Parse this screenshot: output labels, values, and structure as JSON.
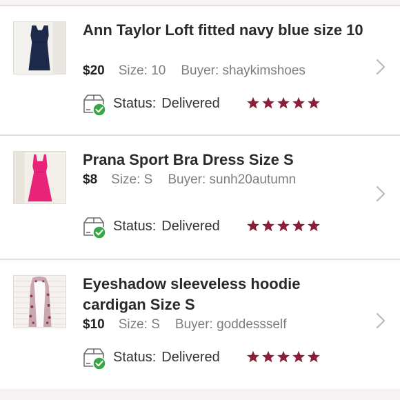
{
  "colors": {
    "star": "#8a1f3a",
    "status_check": "#3aa648",
    "chevron": "#b8b8b8"
  },
  "orders": [
    {
      "title": "Ann Taylor Loft fitted navy blue size 10",
      "price": "$20",
      "size": "Size: 10",
      "buyer": "Buyer: shaykimshoes",
      "status_label": "Status:",
      "status_value": "Delivered",
      "rating": 5,
      "thumb_icon": "navy-dress-photo"
    },
    {
      "title": "Prana Sport Bra Dress Size S",
      "price": "$8",
      "size": "Size: S",
      "buyer": "Buyer: sunh20autumn",
      "status_label": "Status:",
      "status_value": "Delivered",
      "rating": 5,
      "thumb_icon": "pink-dress-photo"
    },
    {
      "title": "Eyeshadow sleeveless hoodie cardigan Size S",
      "price": "$10",
      "size": "Size: S",
      "buyer": "Buyer: goddessself",
      "status_label": "Status:",
      "status_value": "Delivered",
      "rating": 5,
      "thumb_icon": "patterned-cardigan-photo"
    }
  ]
}
